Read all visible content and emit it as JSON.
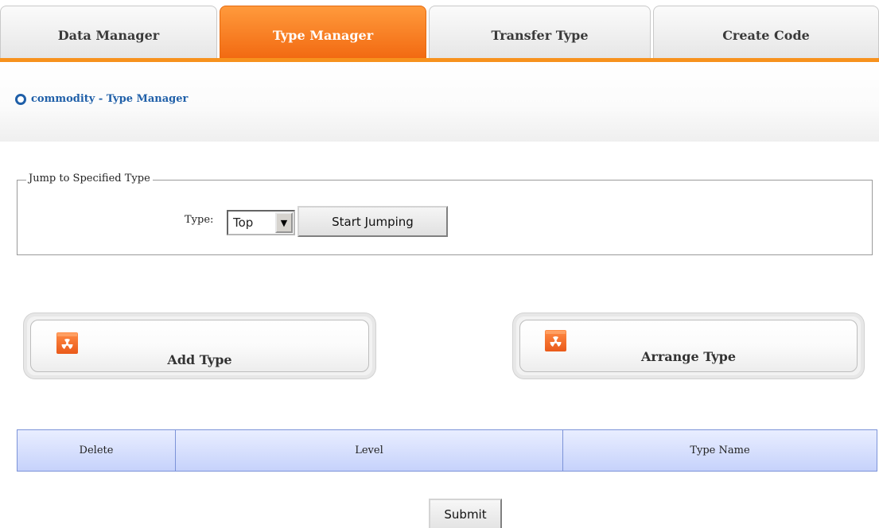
{
  "tabs": [
    {
      "label": "Data Manager",
      "active": false
    },
    {
      "label": "Type Manager",
      "active": true
    },
    {
      "label": "Transfer Type",
      "active": false
    },
    {
      "label": "Create Code",
      "active": false
    }
  ],
  "breadcrumb": {
    "text": "commodity - Type Manager"
  },
  "jump": {
    "legend": "Jump to Specified Type",
    "type_label": "Type:",
    "type_selected": "Top",
    "start_button": "Start Jumping"
  },
  "actions": {
    "add_type": "Add Type",
    "arrange_type": "Arrange Type"
  },
  "table": {
    "headers": [
      "Delete",
      "Level",
      "Type Name"
    ]
  },
  "submit_label": "Submit",
  "colors": {
    "accent_orange": "#f7921e",
    "link_blue": "#1f5fa8",
    "table_header": "#c6d2fb"
  }
}
